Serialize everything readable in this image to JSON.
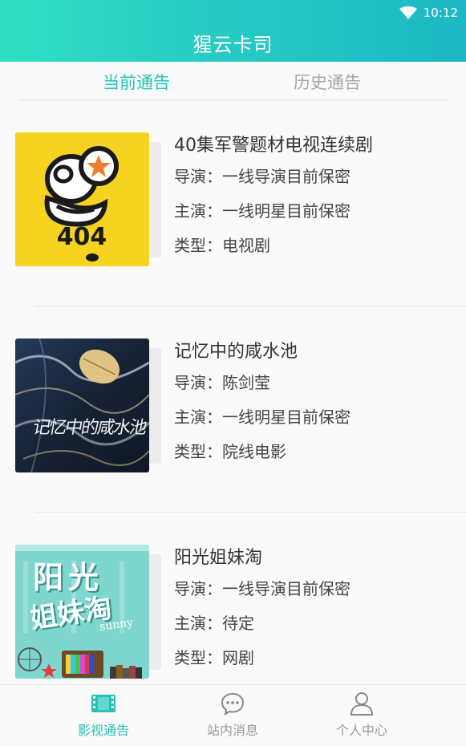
{
  "status_bar": {
    "time": "10:12"
  },
  "header": {
    "title": "猩云卡司"
  },
  "tabs": [
    {
      "label": "当前通告",
      "active": true
    },
    {
      "label": "历史通告",
      "active": false
    }
  ],
  "items": [
    {
      "title": "40集军警题材电视连续剧",
      "director": "导演：一线导演目前保密",
      "cast": "主演：一线明星目前保密",
      "type": "类型：电视剧",
      "poster": {
        "text": "404",
        "bg": "#f7d321"
      }
    },
    {
      "title": "记忆中的咸水池",
      "director": "导演：陈剑莹",
      "cast": "主演：一线明星目前保密",
      "type": "类型：院线电影",
      "poster": {
        "text": "记忆中的咸水池",
        "bg": "#1d2a3e"
      }
    },
    {
      "title": "阳光姐妹淘",
      "director": "导演：一线导演目前保密",
      "cast": "主演：待定",
      "type": "类型：网剧",
      "poster": {
        "line1": "阳光",
        "line2": "姐妹淘",
        "tag": "sunny",
        "bg": "#7ed6cf"
      }
    }
  ],
  "bottom_nav": [
    {
      "label": "影视通告",
      "icon": "film-icon",
      "active": true
    },
    {
      "label": "站内消息",
      "icon": "chat-bubble-icon",
      "active": false
    },
    {
      "label": "个人中心",
      "icon": "person-icon",
      "active": false
    }
  ],
  "colors": {
    "accent": "#22c4b8",
    "header_start": "#2ee0c3",
    "header_end": "#1db8c4",
    "inactive": "#999999"
  }
}
